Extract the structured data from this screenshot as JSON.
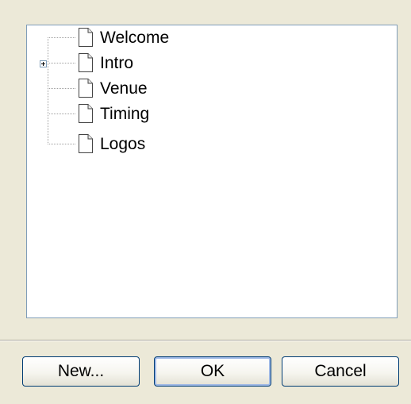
{
  "tree": {
    "items": [
      {
        "label": "Welcome",
        "icon": "page-icon",
        "expandable": false
      },
      {
        "label": "Intro",
        "icon": "page-icon",
        "expandable": true
      },
      {
        "label": "Venue",
        "icon": "page-icon",
        "expandable": false
      },
      {
        "label": "Timing",
        "icon": "page-icon",
        "expandable": false
      },
      {
        "label": "Logos",
        "icon": "page-icon",
        "expandable": false
      }
    ]
  },
  "buttons": {
    "new_label": "New...",
    "ok_label": "OK",
    "cancel_label": "Cancel"
  },
  "colors": {
    "dialog_background": "#ece9d8",
    "tree_border": "#7f9db9",
    "button_border": "#003c74"
  }
}
